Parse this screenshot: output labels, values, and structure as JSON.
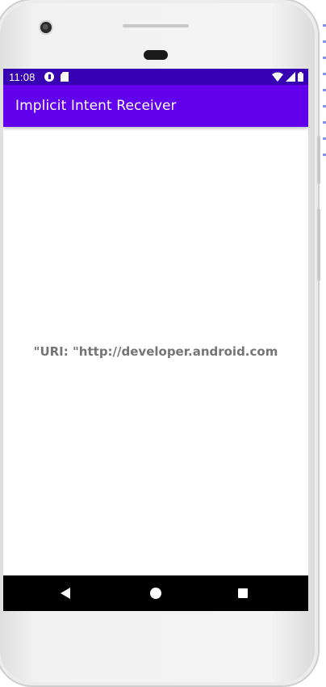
{
  "status_bar": {
    "time": "11:08",
    "notification_icons": [
      "notification-badge-icon",
      "sd-card-icon"
    ],
    "system_icons": [
      "wifi-icon",
      "signal-icon",
      "battery-icon"
    ],
    "color": "#3700b3"
  },
  "app_bar": {
    "title": "Implicit Intent Receiver",
    "color": "#6200ee"
  },
  "content": {
    "uri_text": "\"URI: \"http://developer.android.com"
  },
  "nav_bar": {
    "buttons": [
      "back-icon",
      "home-icon",
      "recents-icon"
    ]
  }
}
